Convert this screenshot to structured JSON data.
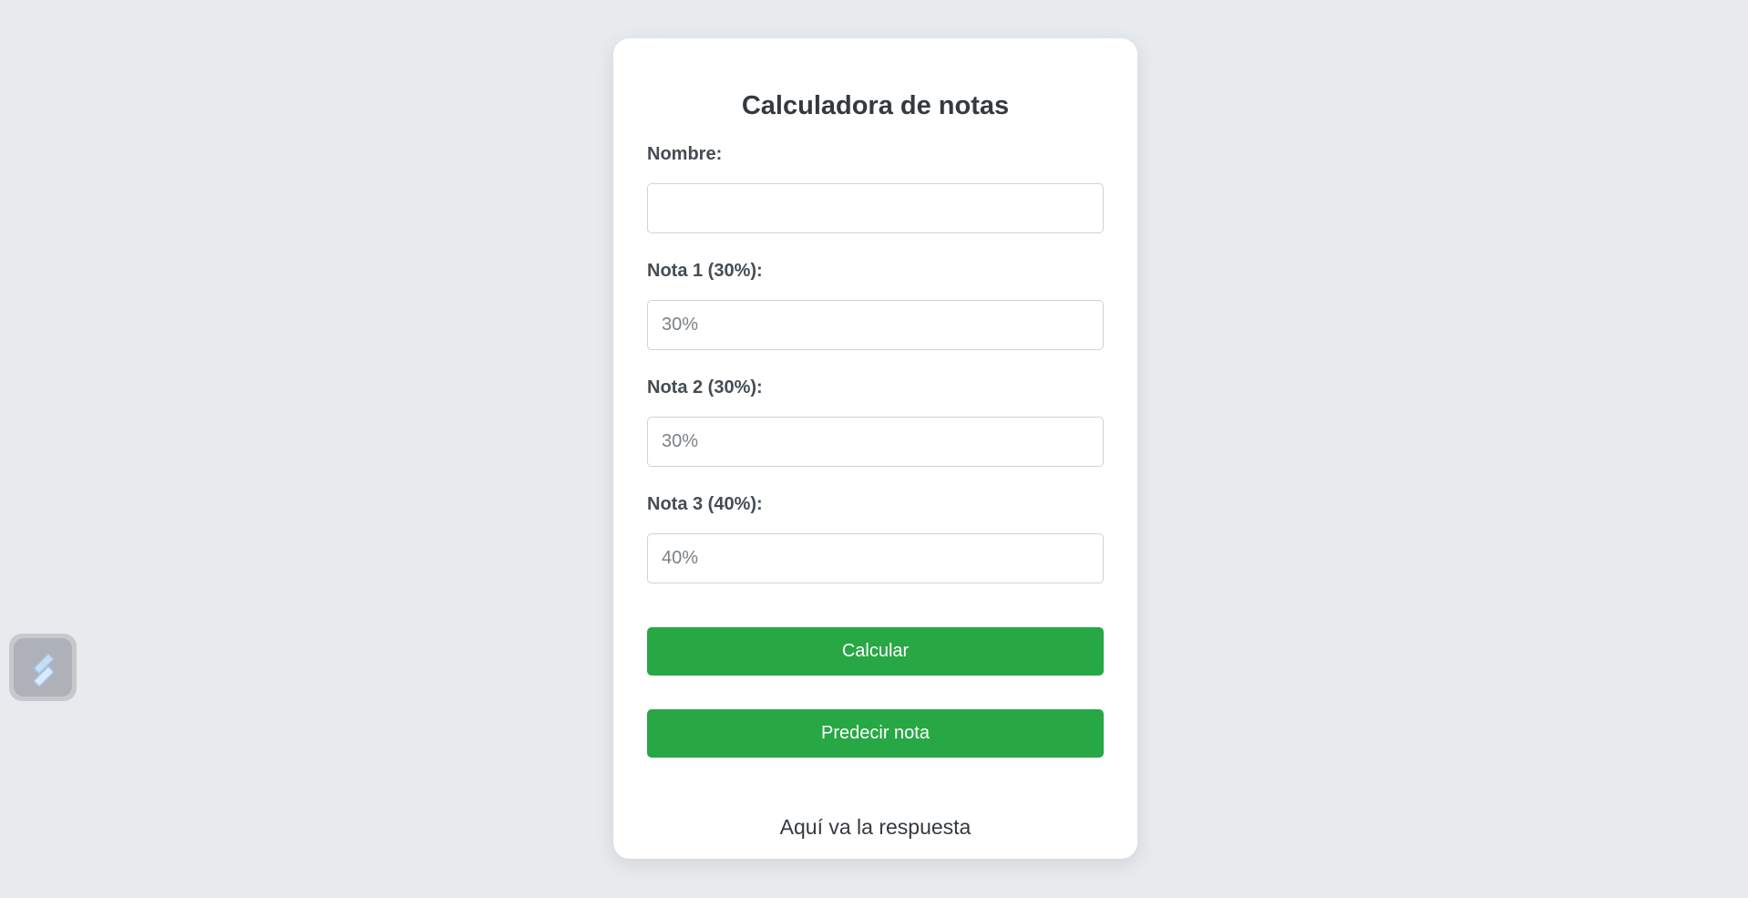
{
  "form": {
    "title": "Calculadora de notas",
    "fields": [
      {
        "label": "Nombre:",
        "value": "",
        "placeholder": ""
      },
      {
        "label": "Nota 1 (30%):",
        "value": "",
        "placeholder": "30%"
      },
      {
        "label": "Nota 2 (30%):",
        "value": "",
        "placeholder": "30%"
      },
      {
        "label": "Nota 3 (40%):",
        "value": "",
        "placeholder": "40%"
      }
    ],
    "calculate_label": "Calcular",
    "predict_label": "Predecir nota",
    "result_text": "Aquí va la respuesta"
  },
  "colors": {
    "background": "#e8ebee",
    "card": "#ffffff",
    "button": "#28a745",
    "text": "#333a40"
  },
  "widget": {
    "icon": "pen-icon"
  }
}
